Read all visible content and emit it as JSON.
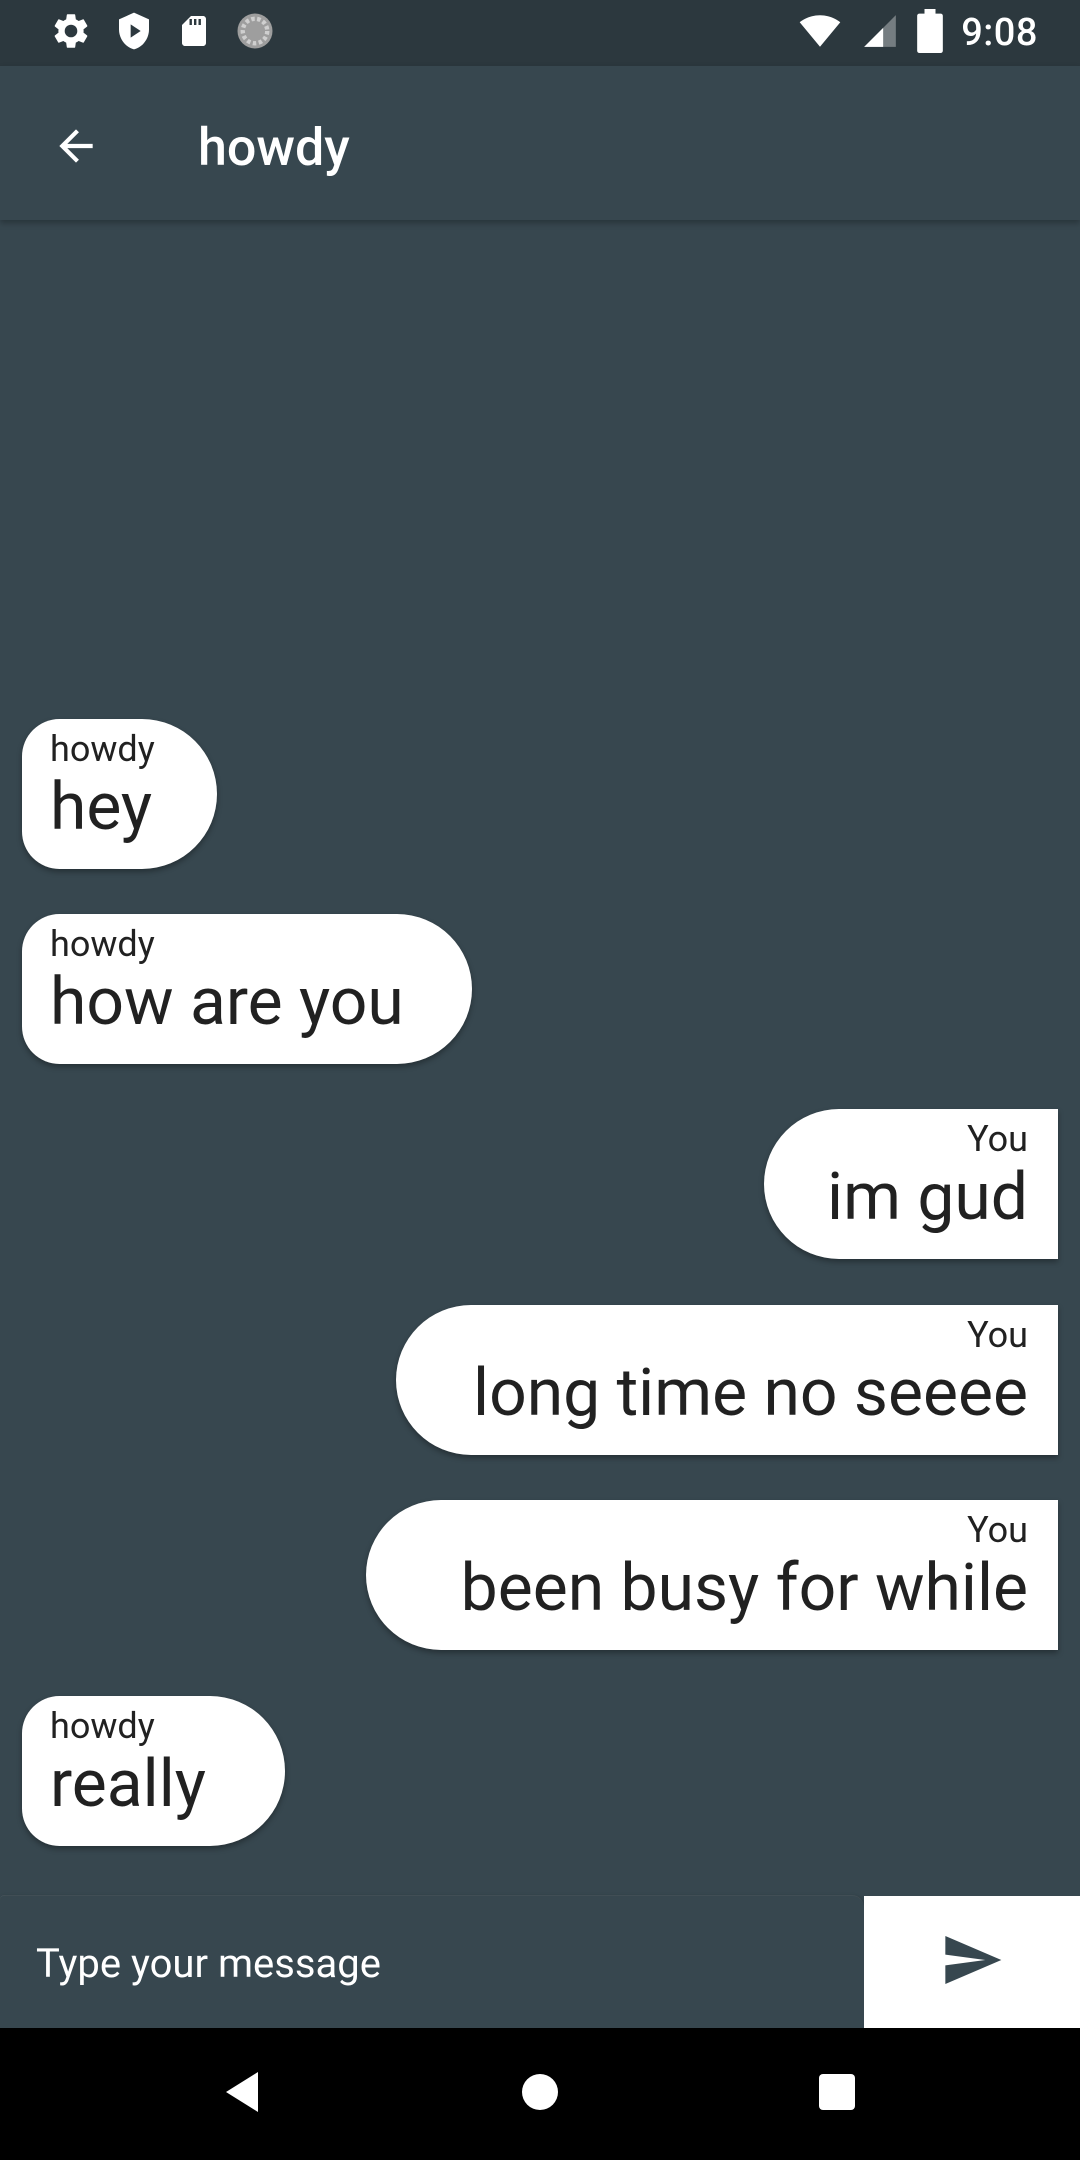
{
  "status_bar": {
    "time": "9:08",
    "left_icons": [
      "settings-icon",
      "shield-play-icon",
      "sd-card-icon",
      "sync-circle-icon"
    ],
    "right_icons": [
      "wifi-icon",
      "cellular-signal-icon",
      "battery-icon"
    ]
  },
  "app_bar": {
    "back_icon": "arrow-back-icon",
    "title": "howdy"
  },
  "messages": [
    {
      "side": "left",
      "sender": "howdy",
      "text": "hey"
    },
    {
      "side": "left",
      "sender": "howdy",
      "text": "how are you"
    },
    {
      "side": "right",
      "sender": "You",
      "text": "im gud"
    },
    {
      "side": "right",
      "sender": "You",
      "text": "long time no seeee"
    },
    {
      "side": "right",
      "sender": "You",
      "text": "been busy for while"
    },
    {
      "side": "left",
      "sender": "howdy",
      "text": "really"
    }
  ],
  "composer": {
    "placeholder": "Type your message",
    "value": "",
    "send_icon": "send-icon"
  },
  "nav_bar": {
    "icons": [
      "nav-back-icon",
      "nav-home-icon",
      "nav-recents-icon"
    ]
  },
  "colors": {
    "background": "#37474f",
    "status_bar": "#2c383e",
    "bubble": "#ffffff",
    "bubble_text": "#212121",
    "nav_bar": "#000000"
  }
}
